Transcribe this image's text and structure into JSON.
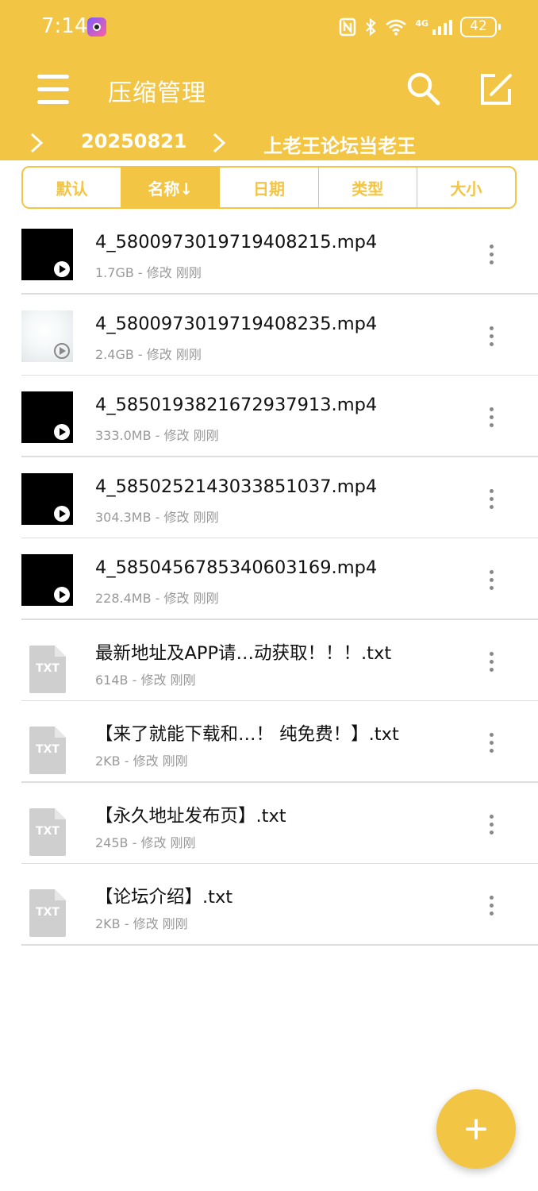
{
  "status_bar": {
    "time": "7:14",
    "network_label": "4G",
    "battery": "42",
    "icons": [
      "camera-app-icon",
      "nfc-icon",
      "bluetooth-icon",
      "wifi-icon",
      "signal-icon",
      "battery-icon"
    ]
  },
  "app_bar": {
    "title": "压缩管理",
    "icons": [
      "menu-icon",
      "search-icon",
      "edit-icon"
    ]
  },
  "breadcrumb": [
    "20250821",
    "上老王论坛当老王"
  ],
  "sort_tabs": [
    {
      "label": "默认",
      "active": false
    },
    {
      "label": "名称↓",
      "active": true
    },
    {
      "label": "日期",
      "active": false
    },
    {
      "label": "类型",
      "active": false
    },
    {
      "label": "大小",
      "active": false
    }
  ],
  "files": [
    {
      "name": "4_5800973019719408215.mp4",
      "meta": "1.7GB - 修改 刚刚",
      "type": "video"
    },
    {
      "name": "4_5800973019719408235.mp4",
      "meta": "2.4GB - 修改 刚刚",
      "type": "video-light"
    },
    {
      "name": "4_5850193821672937913.mp4",
      "meta": "333.0MB - 修改 刚刚",
      "type": "video"
    },
    {
      "name": "4_5850252143033851037.mp4",
      "meta": "304.3MB - 修改 刚刚",
      "type": "video"
    },
    {
      "name": "4_5850456785340603169.mp4",
      "meta": "228.4MB - 修改 刚刚",
      "type": "video"
    },
    {
      "name": "最新地址及APP请…动获取！！！.txt",
      "meta": "614B - 修改 刚刚",
      "type": "txt"
    },
    {
      "name": "【来了就能下载和…！ 纯免费！】.txt",
      "meta": "2KB - 修改 刚刚",
      "type": "txt"
    },
    {
      "name": "【永久地址发布页】.txt",
      "meta": "245B - 修改 刚刚",
      "type": "txt"
    },
    {
      "name": "【论坛介绍】.txt",
      "meta": "2KB - 修改 刚刚",
      "type": "txt"
    }
  ],
  "txt_icon_label": "TXT",
  "colors": {
    "accent": "#F2C544",
    "divider": "#dddddd",
    "meta_text": "#999999"
  },
  "fab": {
    "icon": "plus-icon"
  }
}
